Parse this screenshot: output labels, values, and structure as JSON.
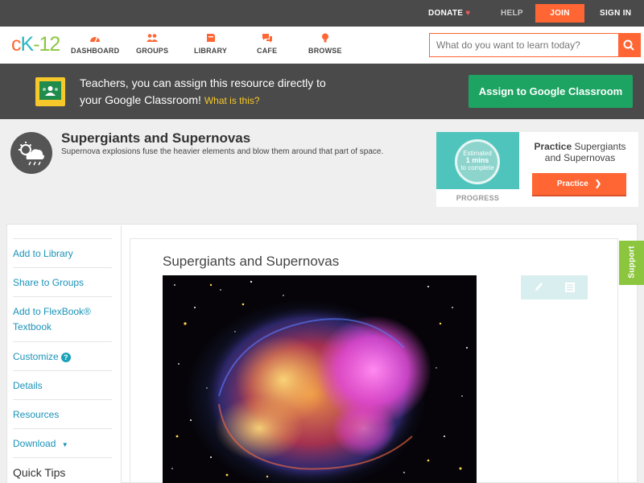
{
  "utility": {
    "donate": "DONATE",
    "help": "HELP",
    "join": "JOIN",
    "signin": "SIGN IN"
  },
  "brand": {
    "logo_c": "c",
    "logo_k": "K",
    "logo_num": "-12"
  },
  "nav": {
    "items": [
      {
        "label": "DASHBOARD",
        "icon": "dashboard-icon"
      },
      {
        "label": "GROUPS",
        "icon": "groups-icon"
      },
      {
        "label": "LIBRARY",
        "icon": "library-icon"
      },
      {
        "label": "CAFE",
        "icon": "cafe-icon"
      },
      {
        "label": "BROWSE",
        "icon": "browse-icon"
      }
    ],
    "search_placeholder": "What do you want to learn today?"
  },
  "teacher": {
    "message_line1": "Teachers, you can assign this resource directly to",
    "message_line2": "your Google Classroom!",
    "what_link": "What is this?",
    "assign_button": "Assign to Google Classroom"
  },
  "concept": {
    "title": "Supergiants and Supernovas",
    "summary": "Supernova explosions fuse the heavier elements and blow them around that part of space."
  },
  "progress": {
    "estimated_line1": "Estimated",
    "estimated_line2": "1 mins",
    "estimated_line3": "to complete",
    "label": "PROGRESS",
    "practice_prefix": "Practice",
    "practice_title": "Supergiants and Supernovas",
    "practice_button": "Practice"
  },
  "sidebar": {
    "items": [
      "Add to Library",
      "Share to Groups",
      "Add to FlexBook®",
      "Textbook",
      "Customize",
      "Details",
      "Resources",
      "Download",
      "Quick Tips"
    ],
    "customize_badge": "?",
    "download_caret": "▼"
  },
  "reader": {
    "title": "Supergiants and Supernovas"
  },
  "support": {
    "label": "Support"
  },
  "colors": {
    "accent_orange": "#ff6633",
    "teal": "#1a92b8",
    "green": "#8cc63f",
    "classroom_green": "#1da463",
    "dark_bar": "#4a4a4a"
  }
}
